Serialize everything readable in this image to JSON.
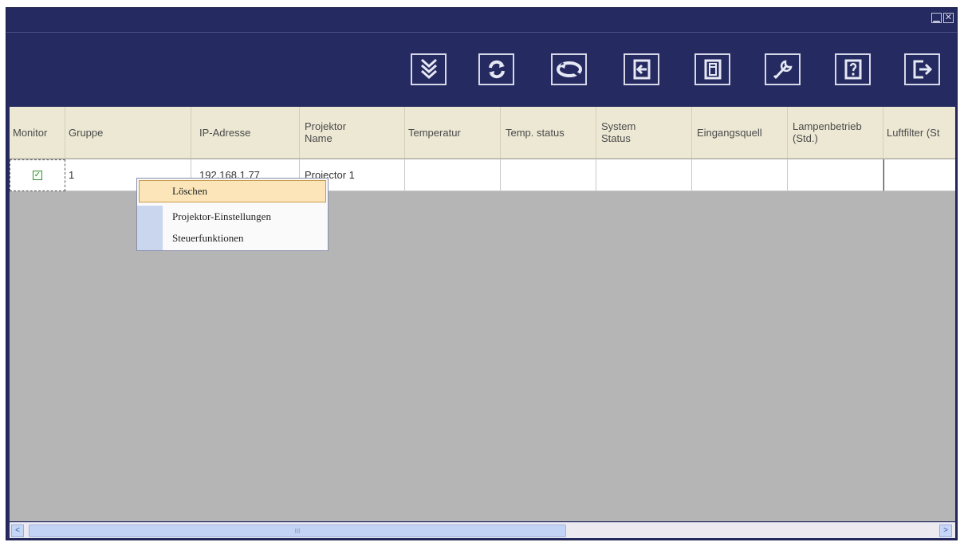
{
  "window": {
    "controls": {
      "minimize": "▁",
      "close": "✕"
    }
  },
  "toolbar": {
    "buttons": [
      {
        "name": "search-projectors-button",
        "icon": "down-arrows-icon"
      },
      {
        "name": "refresh-button",
        "icon": "refresh-icon"
      },
      {
        "name": "connect-button",
        "icon": "link-icon"
      },
      {
        "name": "import-button",
        "icon": "import-icon"
      },
      {
        "name": "save-button",
        "icon": "save-icon"
      },
      {
        "name": "tools-button",
        "icon": "wrench-icon"
      },
      {
        "name": "help-button",
        "icon": "help-icon"
      },
      {
        "name": "exit-button",
        "icon": "exit-icon"
      }
    ]
  },
  "table": {
    "headers": [
      "Monitor",
      "Gruppe",
      "IP-Adresse",
      "Projektor\nName",
      "Temperatur",
      "Temp. status",
      "System\nStatus",
      "Eingangsquell",
      "Lampenbetrieb\n(Std.)",
      "Luftfilter (St"
    ],
    "rows": [
      {
        "monitor_checked": true,
        "check_glyph": "✓",
        "gruppe": "1",
        "ip": "192.168.1.77",
        "name": "Projector 1"
      }
    ]
  },
  "context_menu": {
    "items": [
      "Löschen",
      "Projektor-Einstellungen",
      "Steuerfunktionen"
    ]
  },
  "scrollbar": {
    "left_arrow": "<",
    "right_arrow": ">",
    "grip": "III"
  },
  "colors": {
    "window_bg": "#252a60",
    "header_bg": "#ece8d4",
    "grid_bg": "#b5b5b5",
    "highlight": "#fce6b9"
  }
}
